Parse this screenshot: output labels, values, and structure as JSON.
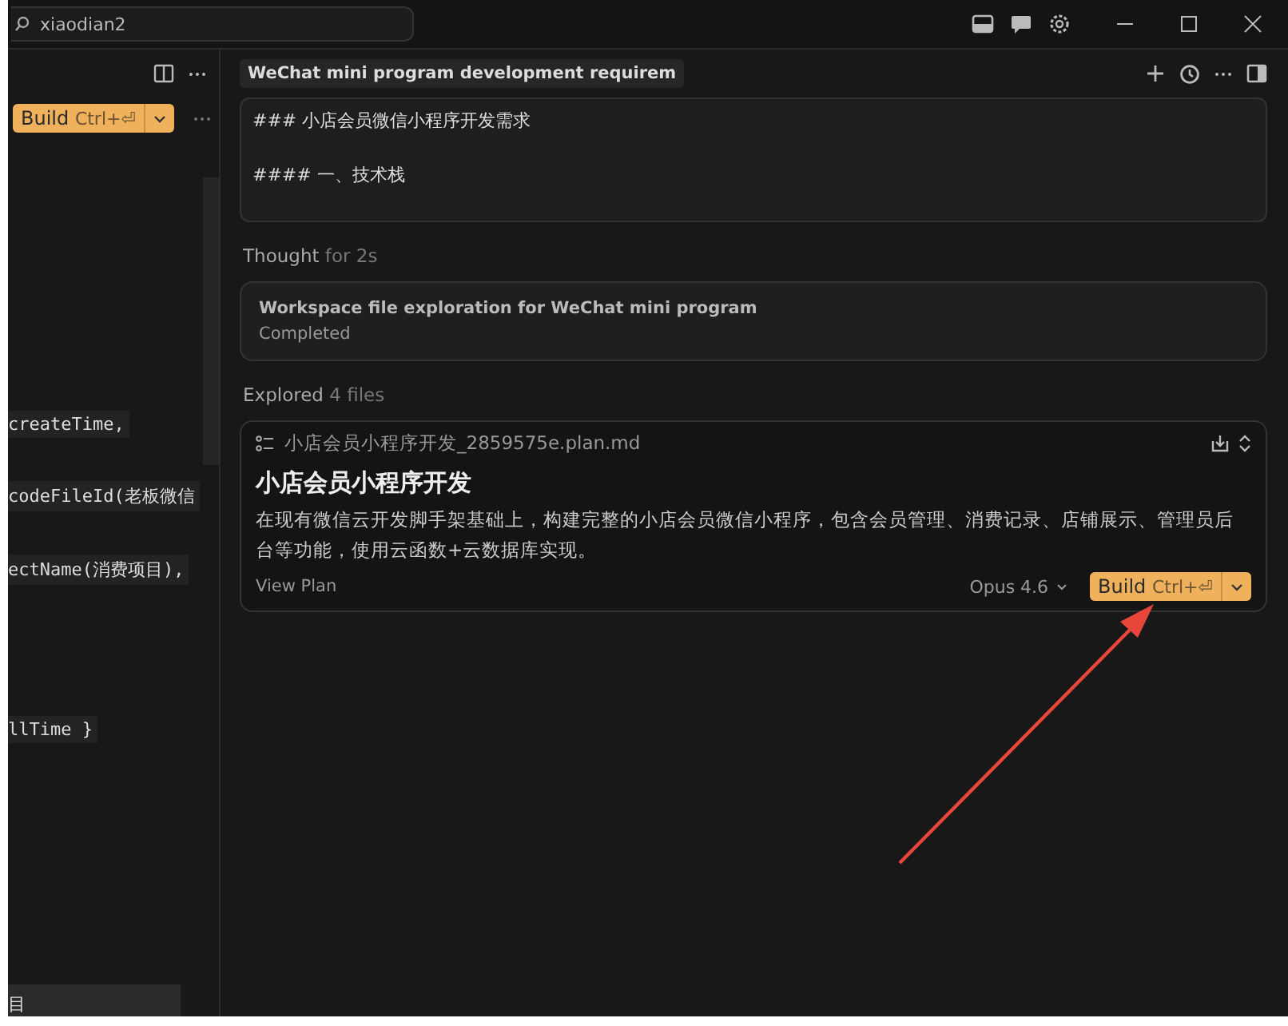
{
  "title_bar": {
    "search_value": "xiaodian2"
  },
  "left_panel": {
    "build_button": {
      "label": "Build",
      "shortcut": "Ctrl+⏎"
    },
    "code_lines": [
      "createTime,",
      "codeFileId(老板微信",
      "ectName(消费项目),",
      "llTime }"
    ],
    "bottom_tab": "目"
  },
  "chat": {
    "tab_title": "WeChat mini program development requirem",
    "message_lines": [
      "### 小店会员微信小程序开发需求",
      "#### 一、技术栈"
    ],
    "thought": {
      "label": "Thought",
      "detail": "for 2s"
    },
    "task": {
      "title": "Workspace file exploration for WeChat mini program",
      "status": "Completed"
    },
    "explored": {
      "label": "Explored",
      "detail": "4 files"
    },
    "plan": {
      "file": "小店会员小程序开发_2859575e.plan.md",
      "title": "小店会员小程序开发",
      "description": "在现有微信云开发脚手架基础上，构建完整的小店会员微信小程序，包含会员管理、消费记录、店铺展示、管理员后台等功能，使用云函数+云数据库实现。",
      "link": "View Plan",
      "model": "Opus 4.6",
      "build_button": {
        "label": "Build",
        "shortcut": "Ctrl+⏎"
      }
    }
  }
}
